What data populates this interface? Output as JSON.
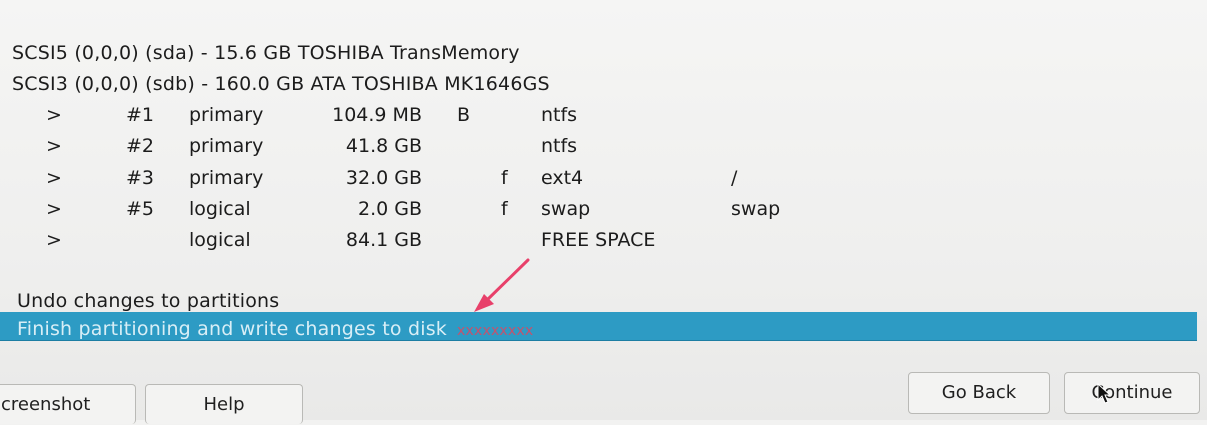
{
  "disks": [
    {
      "label": "SCSI5 (0,0,0) (sda) - 15.6 GB TOSHIBA TransMemory"
    },
    {
      "label": "SCSI3 (0,0,0) (sdb) - 160.0 GB ATA TOSHIBA MK1646GS"
    }
  ],
  "partitions": [
    {
      "arrow": ">",
      "num": "#1",
      "type": "primary",
      "size": "104.9 MB",
      "boot": "B",
      "flag": "",
      "fs": "ntfs",
      "mount": ""
    },
    {
      "arrow": ">",
      "num": "#2",
      "type": "primary",
      "size": "41.8 GB",
      "boot": "",
      "flag": "",
      "fs": "ntfs",
      "mount": ""
    },
    {
      "arrow": ">",
      "num": "#3",
      "type": "primary",
      "size": "32.0 GB",
      "boot": "",
      "flag": "f",
      "fs": "ext4",
      "mount": "/"
    },
    {
      "arrow": ">",
      "num": "#5",
      "type": "logical",
      "size": "2.0 GB",
      "boot": "",
      "flag": "f",
      "fs": "swap",
      "mount": "swap"
    },
    {
      "arrow": ">",
      "num": "",
      "type": "logical",
      "size": "84.1 GB",
      "boot": "",
      "flag": "",
      "fs": "FREE SPACE",
      "mount": ""
    }
  ],
  "actions": {
    "undo": "Undo changes to partitions",
    "finish": "Finish partitioning and write changes to disk"
  },
  "buttons": {
    "screenshot": "creenshot",
    "help": "Help",
    "go_back": "Go Back",
    "continue": "Continue"
  },
  "colors": {
    "selection": "#2d9bc4",
    "annotation_arrow": "#e8406a"
  }
}
